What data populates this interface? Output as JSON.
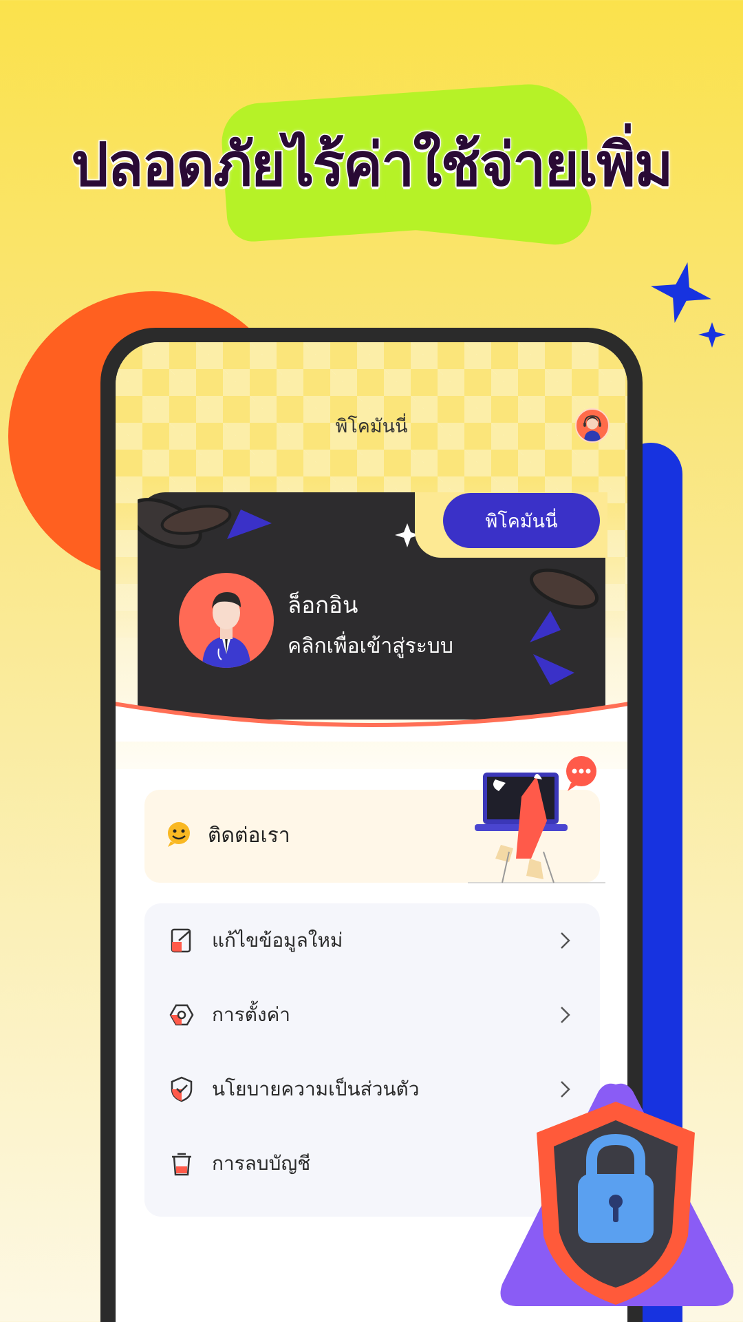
{
  "headline": "ปลอดภัยไร้ค่าใช้จ่ายเพิ่ม",
  "app": {
    "title": "พิโคมันนี่",
    "brand_button": "พิโคมันนี่",
    "login": {
      "title": "ล็อกอิน",
      "subtitle": "คลิกเพื่อเข้าสู่ระบบ"
    },
    "contact": {
      "label": "ติดต่อเรา",
      "icon": "smiley-icon"
    },
    "menu": [
      {
        "label": "แก้ไขข้อมูลใหม่",
        "icon": "edit-icon"
      },
      {
        "label": "การตั้งค่า",
        "icon": "settings-icon"
      },
      {
        "label": "นโยบายความเป็นส่วนตัว",
        "icon": "shield-check-icon"
      },
      {
        "label": "การลบบัญชี",
        "icon": "trash-icon"
      }
    ]
  },
  "colors": {
    "accent_purple": "#3a31c8",
    "accent_orange": "#ff6020",
    "accent_blue": "#1733e0",
    "lime": "#b6f227",
    "card_dark": "#2d2c2e"
  }
}
